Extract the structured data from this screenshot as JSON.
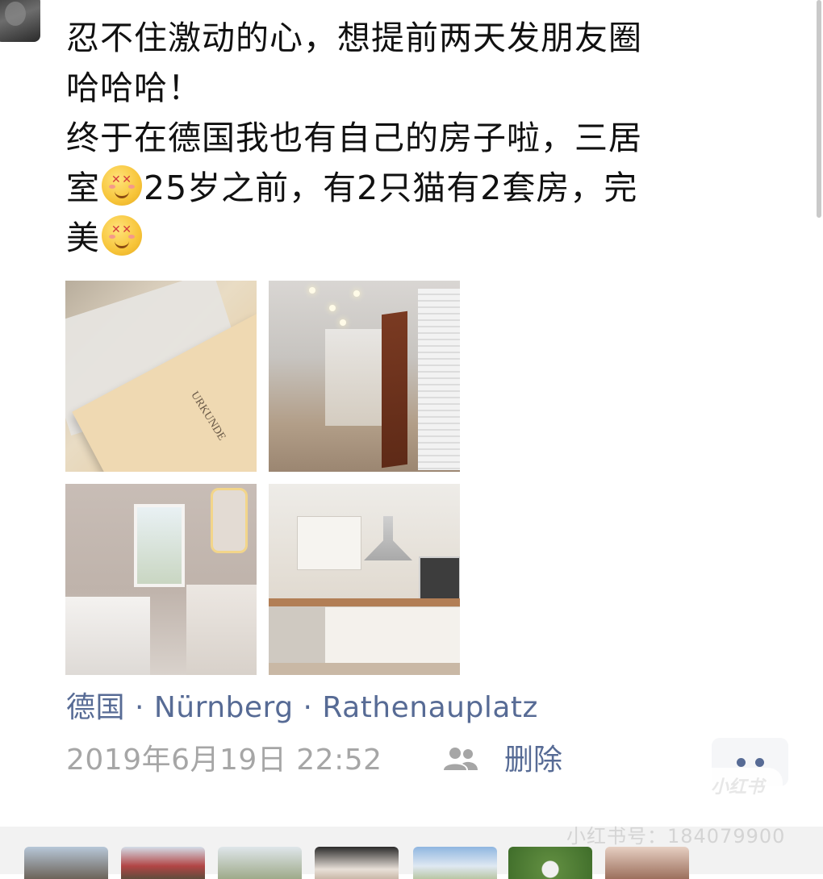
{
  "post": {
    "text_lines": [
      "忍不住激动的心，想提前两天发朋友圈",
      "哈哈哈！",
      "终于在德国我也有自己的房子啦，三居",
      "室",
      "25岁之前，有2只猫有2套房，完",
      "美"
    ],
    "emoji_icon": "smiling-face-with-heart-eyes-icon",
    "photos": [
      {
        "name": "urkunde-document-photo",
        "caption": "URKUNDE"
      },
      {
        "name": "hallway-photo"
      },
      {
        "name": "bathroom-photo"
      },
      {
        "name": "kitchen-photo"
      }
    ],
    "location": "德国 · Nürnberg · Rathenauplatz",
    "timestamp": "2019年6月19日 22:52",
    "visibility_icon": "people-icon",
    "delete_label": "删除",
    "more_icon": "more-dots-icon"
  },
  "watermark": {
    "logo_text": "小红书",
    "id_text": "小红书号：184079900"
  },
  "colors": {
    "link": "#576b95",
    "meta_gray": "#a6a6a6",
    "text": "#111111",
    "more_bg": "#f5f6f8"
  }
}
